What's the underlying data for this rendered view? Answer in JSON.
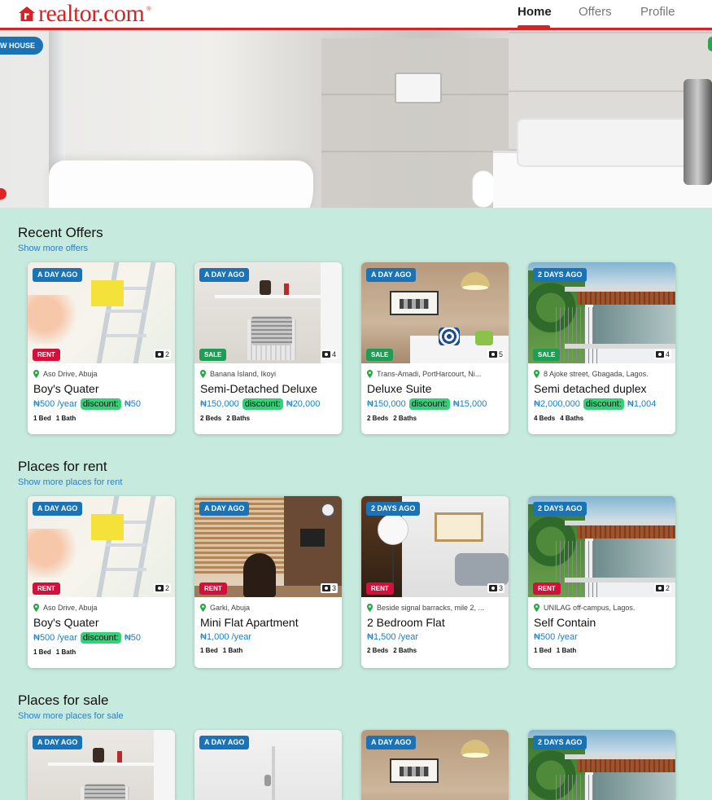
{
  "header": {
    "logo_text": "realtor.com",
    "logo_mark": "®",
    "brand_color": "#d92228",
    "nav": [
      {
        "label": "Home",
        "active": true
      },
      {
        "label": "Offers",
        "active": false
      },
      {
        "label": "Profile",
        "active": false
      }
    ]
  },
  "hero": {
    "tag": "W HOUSE"
  },
  "sections": [
    {
      "title": "Recent Offers",
      "link": "Show more offers",
      "cards": [
        {
          "time": "A DAY AGO",
          "type": "RENT",
          "photos": "2",
          "location": "Aso Drive, Abuja",
          "title": "Boy's Quater",
          "price": "₦500 /year",
          "discount_label": "discount:",
          "discount": "₦50",
          "beds": "1 Bed",
          "baths": "1 Bath"
        },
        {
          "time": "A DAY AGO",
          "type": "SALE",
          "photos": "4",
          "location": "Banana Island, Ikoyi",
          "title": "Semi-Detached Deluxe",
          "price": "₦150,000",
          "discount_label": "discount:",
          "discount": "₦20,000",
          "beds": "2 Beds",
          "baths": "2 Baths"
        },
        {
          "time": "A DAY AGO",
          "type": "SALE",
          "photos": "5",
          "location": "Trans-Amadi, PortHarcourt, Ni...",
          "title": "Deluxe Suite",
          "price": "₦150,000",
          "discount_label": "discount:",
          "discount": "₦15,000",
          "beds": "2 Beds",
          "baths": "2 Baths"
        },
        {
          "time": "2 DAYS AGO",
          "type": "SALE",
          "photos": "4",
          "location": "8 Ajoke street, Gbagada, Lagos.",
          "title": "Semi detached duplex",
          "price": "₦2,000,000",
          "discount_label": "discount:",
          "discount": "₦1,004",
          "beds": "4 Beds",
          "baths": "4 Baths"
        }
      ]
    },
    {
      "title": "Places for rent",
      "link": "Show more places for rent",
      "cards": [
        {
          "time": "A DAY AGO",
          "type": "RENT",
          "photos": "2",
          "location": "Aso Drive, Abuja",
          "title": "Boy's Quater",
          "price": "₦500 /year",
          "discount_label": "discount:",
          "discount": "₦50",
          "beds": "1 Bed",
          "baths": "1 Bath"
        },
        {
          "time": "A DAY AGO",
          "type": "RENT",
          "photos": "3",
          "location": "Garki, Abuja",
          "title": "Mini Flat Apartment",
          "price": "₦1,000 /year",
          "beds": "1 Bed",
          "baths": "1 Bath"
        },
        {
          "time": "2 DAYS AGO",
          "type": "RENT",
          "photos": "3",
          "location": "Beside signal barracks, mile 2, ...",
          "title": "2 Bedroom Flat",
          "price": "₦1,500 /year",
          "beds": "2 Beds",
          "baths": "2 Baths"
        },
        {
          "time": "2 DAYS AGO",
          "type": "RENT",
          "photos": "2",
          "location": "UNILAG off-campus, Lagos.",
          "title": "Self Contain",
          "price": "₦500 /year",
          "beds": "1 Bed",
          "baths": "1 Bath"
        }
      ]
    },
    {
      "title": "Places for sale",
      "link": "Show more places for sale",
      "cards": [
        {
          "time": "A DAY AGO"
        },
        {
          "time": "A DAY AGO"
        },
        {
          "time": "A DAY AGO"
        },
        {
          "time": "2 DAYS AGO"
        }
      ]
    }
  ]
}
